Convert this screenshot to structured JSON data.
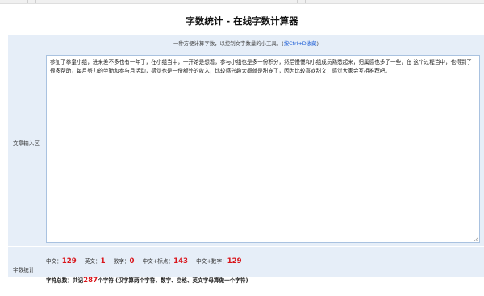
{
  "page": {
    "title": "字数统计 - 在线字数计算器"
  },
  "description": {
    "text": "一种方便计算字数，以控制文字数量的小工具。(",
    "link": "按Ctrl+D收藏",
    "suffix": ")"
  },
  "textarea": {
    "label": "文章输入区",
    "value": "参加了拳皇小组，进来差不多也有一年了，在小组当中，一开始是想着，参与小组也是多一份积分，然后慢慢和小组成员熟悉起来，归属感也多了一些，在 这个过程当中，也得到了很多帮助，每月努力的坐勤和参与月活动，感觉也是一份额外的收入，比较感兴趣大概就是甜宠了，因为比较喜欢甜文，感觉大家会互相推荐吧。"
  },
  "stats": {
    "label": "字数统计",
    "items": [
      {
        "label": "中文：",
        "value": "129"
      },
      {
        "label": "英文：",
        "value": "1"
      },
      {
        "label": "数字：",
        "value": "0"
      },
      {
        "label": "中文+标点：",
        "value": "143"
      },
      {
        "label": "中文+数字：",
        "value": "129"
      }
    ],
    "total_prefix": "字符总数：共记",
    "total_value": "287",
    "total_suffix": "个字符 (汉字算两个字符，数字、空格、英文字母算做一个字符)"
  }
}
